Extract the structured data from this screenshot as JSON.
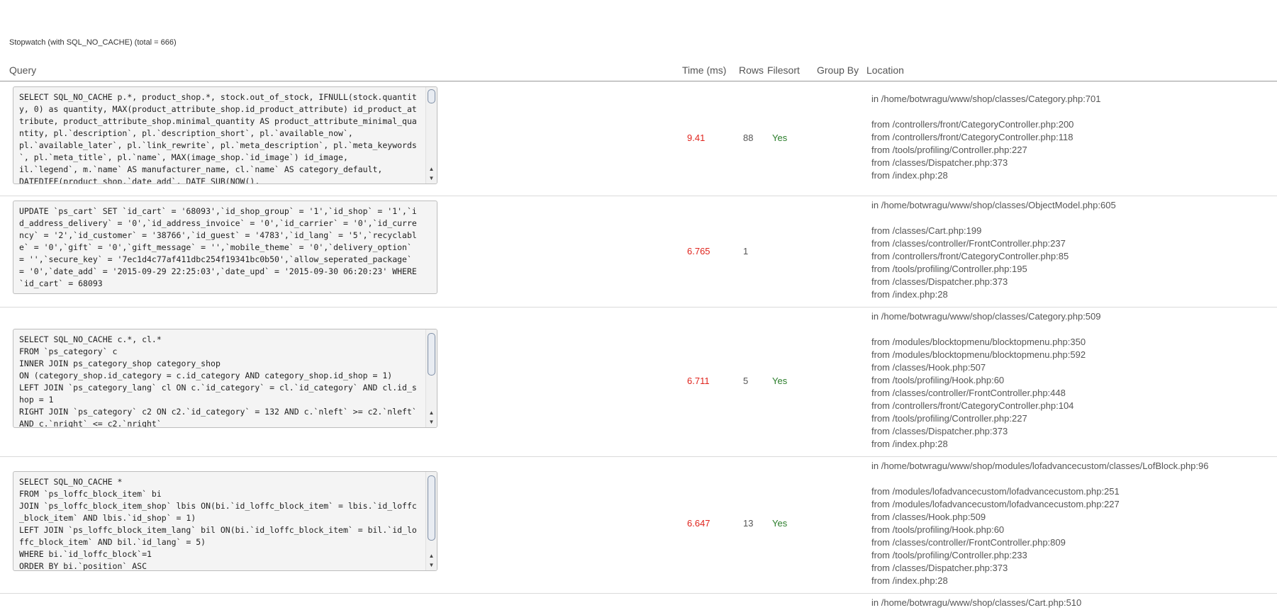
{
  "caption": "Stopwatch (with SQL_NO_CACHE) (total = 666)",
  "columns": {
    "query": "Query",
    "time": "Time (ms)",
    "rows": "Rows",
    "filesort": "Filesort",
    "group_by": "Group By",
    "location": "Location"
  },
  "entries": [
    {
      "query": "SELECT SQL_NO_CACHE p.*, product_shop.*, stock.out_of_stock, IFNULL(stock.quantity, 0) as quantity, MAX(product_attribute_shop.id_product_attribute) id_product_attribute, product_attribute_shop.minimal_quantity AS product_attribute_minimal_quantity, pl.`description`, pl.`description_short`, pl.`available_now`,\npl.`available_later`, pl.`link_rewrite`, pl.`meta_description`, pl.`meta_keywords`, pl.`meta_title`, pl.`name`, MAX(image_shop.`id_image`) id_image,\nil.`legend`, m.`name` AS manufacturer_name, cl.`name` AS category_default,\nDATEDIFF(product_shop.`date_add`, DATE_SUB(NOW(),",
      "time": "9.41",
      "rows": "88",
      "filesort": "Yes",
      "group_by": "",
      "location_in": "in /home/botwragu/www/shop/classes/Category.php:701",
      "location_from": [
        "from /controllers/front/CategoryController.php:200",
        "from /controllers/front/CategoryController.php:118",
        "from /tools/profiling/Controller.php:227",
        "from /classes/Dispatcher.php:373",
        "from /index.php:28"
      ]
    },
    {
      "query": "UPDATE `ps_cart` SET `id_cart` = '68093',`id_shop_group` = '1',`id_shop` = '1',`id_address_delivery` = '0',`id_address_invoice` = '0',`id_carrier` = '0',`id_currency` = '2',`id_customer` = '38766',`id_guest` = '4783',`id_lang` = '5',`recyclable` = '0',`gift` = '0',`gift_message` = '',`mobile_theme` = '0',`delivery_option` = '',`secure_key` = '7ec1d4c77af411dbc254f19341bc0b50',`allow_seperated_package` = '0',`date_add` = '2015-09-29 22:25:03',`date_upd` = '2015-09-30 06:20:23' WHERE `id_cart` = 68093",
      "time": "6.765",
      "rows": "1",
      "filesort": "",
      "group_by": "",
      "location_in": "in /home/botwragu/www/shop/classes/ObjectModel.php:605",
      "location_from": [
        "from /classes/Cart.php:199",
        "from /classes/controller/FrontController.php:237",
        "from /controllers/front/CategoryController.php:85",
        "from /tools/profiling/Controller.php:195",
        "from /classes/Dispatcher.php:373",
        "from /index.php:28"
      ]
    },
    {
      "query": "SELECT SQL_NO_CACHE c.*, cl.*\nFROM `ps_category` c\nINNER JOIN ps_category_shop category_shop\nON (category_shop.id_category = c.id_category AND category_shop.id_shop = 1)\nLEFT JOIN `ps_category_lang` cl ON c.`id_category` = cl.`id_category` AND cl.id_shop = 1\nRIGHT JOIN `ps_category` c2 ON c2.`id_category` = 132 AND c.`nleft` >= c2.`nleft` AND c.`nright` <= c2.`nright`",
      "time": "6.711",
      "rows": "5",
      "filesort": "Yes",
      "group_by": "",
      "location_in": "in /home/botwragu/www/shop/classes/Category.php:509",
      "location_from": [
        "from /modules/blocktopmenu/blocktopmenu.php:350",
        "from /modules/blocktopmenu/blocktopmenu.php:592",
        "from /classes/Hook.php:507",
        "from /tools/profiling/Hook.php:60",
        "from /classes/controller/FrontController.php:448",
        "from /controllers/front/CategoryController.php:104",
        "from /tools/profiling/Controller.php:227",
        "from /classes/Dispatcher.php:373",
        "from /index.php:28"
      ]
    },
    {
      "query": "SELECT SQL_NO_CACHE *\nFROM `ps_loffc_block_item` bi\nJOIN `ps_loffc_block_item_shop` lbis ON(bi.`id_loffc_block_item` = lbis.`id_loffc_block_item` AND lbis.`id_shop` = 1)\nLEFT JOIN `ps_loffc_block_item_lang` bil ON(bi.`id_loffc_block_item` = bil.`id_loffc_block_item` AND bil.`id_lang` = 5)\nWHERE bi.`id_loffc_block`=1\nORDER BY bi.`position` ASC",
      "time": "6.647",
      "rows": "13",
      "filesort": "Yes",
      "group_by": "",
      "location_in": "in /home/botwragu/www/shop/modules/lofadvancecustom/classes/LofBlock.php:96",
      "location_from": [
        "from /modules/lofadvancecustom/lofadvancecustom.php:251",
        "from /modules/lofadvancecustom/lofadvancecustom.php:227",
        "from /classes/Hook.php:509",
        "from /tools/profiling/Hook.php:60",
        "from /classes/controller/FrontController.php:809",
        "from /tools/profiling/Controller.php:233",
        "from /classes/Dispatcher.php:373",
        "from /index.php:28"
      ]
    },
    {
      "location_in": "in /home/botwragu/www/shop/classes/Cart.php:510"
    }
  ]
}
